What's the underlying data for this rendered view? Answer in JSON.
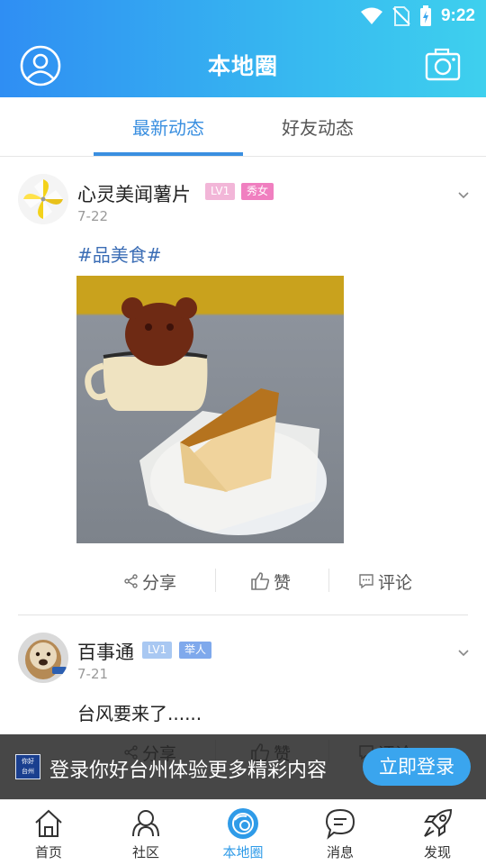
{
  "status_bar": {
    "time": "9:22"
  },
  "header": {
    "title": "本地圈",
    "profile_icon": "user-circle-icon",
    "camera_icon": "camera-icon"
  },
  "tabs": [
    {
      "label": "最新动态",
      "active": true
    },
    {
      "label": "好友动态",
      "active": false
    }
  ],
  "posts": [
    {
      "username": "心灵美闻薯片",
      "level_badge": "LV1",
      "role_badge": "秀女",
      "date": "7-22",
      "hashtag": "#品美食#",
      "actions": {
        "share": "分享",
        "like": "赞",
        "comment": "评论"
      }
    },
    {
      "username": "百事通",
      "level_badge": "LV1",
      "role_badge": "举人",
      "date": "7-21",
      "text": "台风要来了......",
      "actions": {
        "share": "分享",
        "like": "赞",
        "comment": "评论"
      }
    }
  ],
  "login_banner": {
    "logo_text_line1": "你好",
    "logo_text_line2": "台州",
    "message": "登录你好台州体验更多精彩内容",
    "button": "立即登录"
  },
  "bottom_nav": [
    {
      "label": "首页",
      "icon": "home-icon",
      "active": false
    },
    {
      "label": "社区",
      "icon": "community-icon",
      "active": false
    },
    {
      "label": "本地圈",
      "icon": "local-circle-icon",
      "active": true
    },
    {
      "label": "消息",
      "icon": "message-icon",
      "active": false
    },
    {
      "label": "发现",
      "icon": "rocket-icon",
      "active": false
    }
  ],
  "colors": {
    "header_gradient_start": "#2f8ef3",
    "header_gradient_end": "#3ed0ee",
    "accent": "#3a8fe0",
    "hashtag": "#3b6db5",
    "level_badge_pink": "#f2b6d8",
    "role_badge_pink": "#f07fc0",
    "level_badge_blue": "#a9c8f2",
    "role_badge_blue": "#7fa9ec"
  }
}
